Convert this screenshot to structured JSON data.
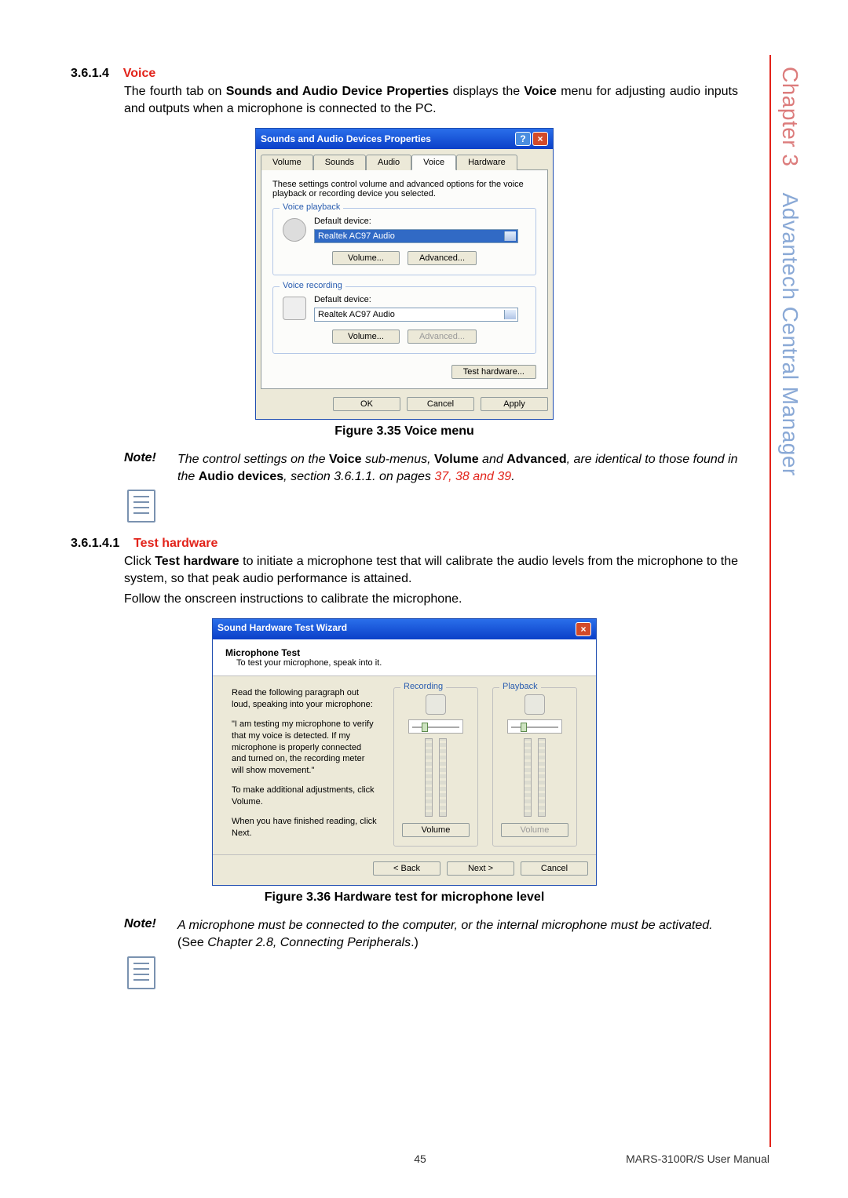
{
  "sideTab": {
    "chapter": "Chapter 3",
    "title": "Advantech Central Manager"
  },
  "sec1": {
    "num": "3.6.1.4",
    "title": "Voice",
    "body_a": "The fourth tab on ",
    "body_b": "Sounds and Audio Device Properties",
    "body_c": " displays the ",
    "body_d": "Voice",
    "body_e": " menu for adjusting audio inputs and outputs when a microphone is connected to the PC."
  },
  "dlg": {
    "title": "Sounds and Audio Devices Properties",
    "tabs": {
      "volume": "Volume",
      "sounds": "Sounds",
      "audio": "Audio",
      "voice": "Voice",
      "hardware": "Hardware"
    },
    "desc": "These settings control volume and advanced options for the voice playback or recording device you selected.",
    "playback_group": "Voice playback",
    "recording_group": "Voice recording",
    "default_device": "Default device:",
    "device_value": "Realtek AC97 Audio",
    "btn_volume": "Volume...",
    "btn_advanced": "Advanced...",
    "btn_testhw": "Test hardware...",
    "ok": "OK",
    "cancel": "Cancel",
    "apply": "Apply"
  },
  "figcap1": "Figure 3.35 Voice menu",
  "note1": {
    "label": "Note!",
    "a": "The control settings on the ",
    "b": "Voice",
    "c": " sub-menus, ",
    "d": "Volume",
    "e": " and ",
    "f": "Advanced",
    "g": ", are identical to those found in the ",
    "h": "Audio devices",
    "i": ", section 3.6.1.1. on pages ",
    "j": "37, 38 and 39",
    "k": "."
  },
  "sec2": {
    "num": "3.6.1.4.1",
    "title": "Test hardware",
    "p1a": "Click ",
    "p1b": "Test hardware",
    "p1c": " to initiate a microphone test that will calibrate the audio levels from the microphone to the system, so that peak audio performance is attained.",
    "p2": "Follow the onscreen instructions to calibrate the microphone."
  },
  "wiz": {
    "title": "Sound Hardware Test Wizard",
    "head_title": "Microphone Test",
    "head_sub": "To test your microphone, speak into it.",
    "left_p1": "Read the following paragraph out loud, speaking into your microphone:",
    "left_p2": "\"I am testing my microphone to verify that my voice is detected. If my microphone is properly connected and turned on, the recording meter will show movement.\"",
    "left_p3": "To make additional adjustments, click Volume.",
    "left_p4": "When you have finished reading, click Next.",
    "recording": "Recording",
    "playback": "Playback",
    "volume": "Volume",
    "back": "< Back",
    "next": "Next >",
    "cancel": "Cancel"
  },
  "figcap2": "Figure 3.36 Hardware test for microphone level",
  "note2": {
    "label": "Note!",
    "a": "A microphone must be connected to the computer, or the internal microphone must be activated.",
    "b": " (See ",
    "c": "Chapter 2.8, Connecting Peripherals",
    "d": ".)"
  },
  "footer": {
    "page": "45",
    "manual": "MARS-3100R/S User Manual"
  }
}
